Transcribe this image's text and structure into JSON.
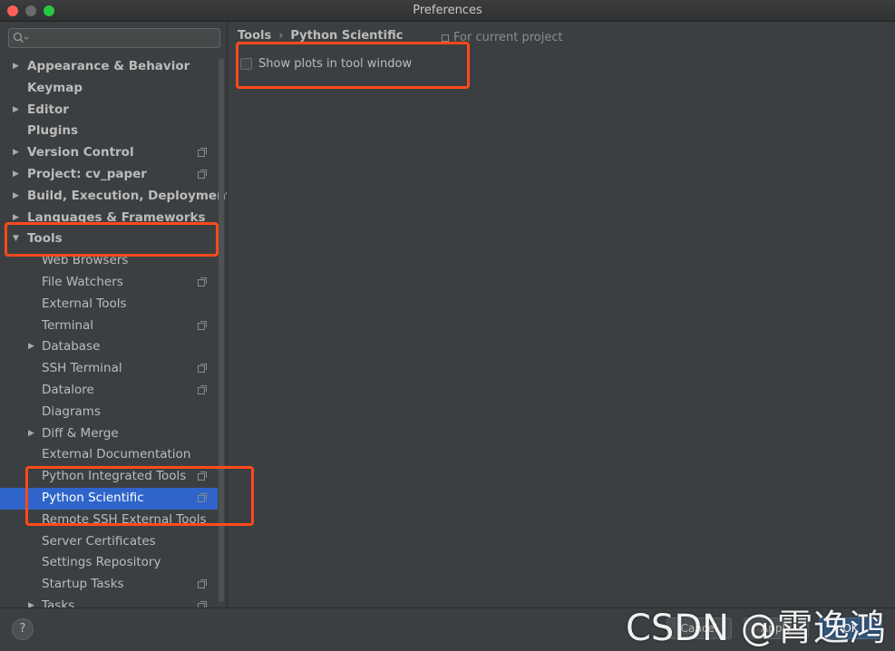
{
  "window": {
    "title": "Preferences"
  },
  "search": {
    "placeholder": ""
  },
  "tree": [
    {
      "label": "Appearance & Behavior",
      "level": 0,
      "arrow": "right",
      "project": false
    },
    {
      "label": "Keymap",
      "level": 0,
      "arrow": "",
      "project": false
    },
    {
      "label": "Editor",
      "level": 0,
      "arrow": "right",
      "project": false
    },
    {
      "label": "Plugins",
      "level": 0,
      "arrow": "",
      "project": false
    },
    {
      "label": "Version Control",
      "level": 0,
      "arrow": "right",
      "project": true
    },
    {
      "label": "Project: cv_paper",
      "level": 0,
      "arrow": "right",
      "project": true
    },
    {
      "label": "Build, Execution, Deployment",
      "level": 0,
      "arrow": "right",
      "project": false
    },
    {
      "label": "Languages & Frameworks",
      "level": 0,
      "arrow": "right",
      "project": false
    },
    {
      "label": "Tools",
      "level": 0,
      "arrow": "down",
      "project": false
    },
    {
      "label": "Web Browsers",
      "level": 1,
      "arrow": "",
      "project": false
    },
    {
      "label": "File Watchers",
      "level": 1,
      "arrow": "",
      "project": true
    },
    {
      "label": "External Tools",
      "level": 1,
      "arrow": "",
      "project": false
    },
    {
      "label": "Terminal",
      "level": 1,
      "arrow": "",
      "project": true
    },
    {
      "label": "Database",
      "level": 1,
      "arrow": "right",
      "project": false
    },
    {
      "label": "SSH Terminal",
      "level": 1,
      "arrow": "",
      "project": true
    },
    {
      "label": "Datalore",
      "level": 1,
      "arrow": "",
      "project": true
    },
    {
      "label": "Diagrams",
      "level": 1,
      "arrow": "",
      "project": false
    },
    {
      "label": "Diff & Merge",
      "level": 1,
      "arrow": "right",
      "project": false
    },
    {
      "label": "External Documentation",
      "level": 1,
      "arrow": "",
      "project": false
    },
    {
      "label": "Python Integrated Tools",
      "level": 1,
      "arrow": "",
      "project": true
    },
    {
      "label": "Python Scientific",
      "level": 1,
      "arrow": "",
      "project": true,
      "selected": true
    },
    {
      "label": "Remote SSH External Tools",
      "level": 1,
      "arrow": "",
      "project": false
    },
    {
      "label": "Server Certificates",
      "level": 1,
      "arrow": "",
      "project": false
    },
    {
      "label": "Settings Repository",
      "level": 1,
      "arrow": "",
      "project": false
    },
    {
      "label": "Startup Tasks",
      "level": 1,
      "arrow": "",
      "project": true
    },
    {
      "label": "Tasks",
      "level": 1,
      "arrow": "right",
      "project": true
    }
  ],
  "main": {
    "breadcrumb": [
      "Tools",
      "Python Scientific"
    ],
    "breadcrumb_sep": "›",
    "scope_label": "For current project",
    "checkbox_label": "Show plots in tool window",
    "checkbox_checked": false
  },
  "footer": {
    "help": "?",
    "cancel": "Cancel",
    "apply": "Apply",
    "ok": "OK"
  },
  "watermark": "CSDN @霄逸鸿",
  "colors": {
    "highlight": "#ff4a1c",
    "selection": "#2f65ca",
    "background": "#3c3f41"
  }
}
